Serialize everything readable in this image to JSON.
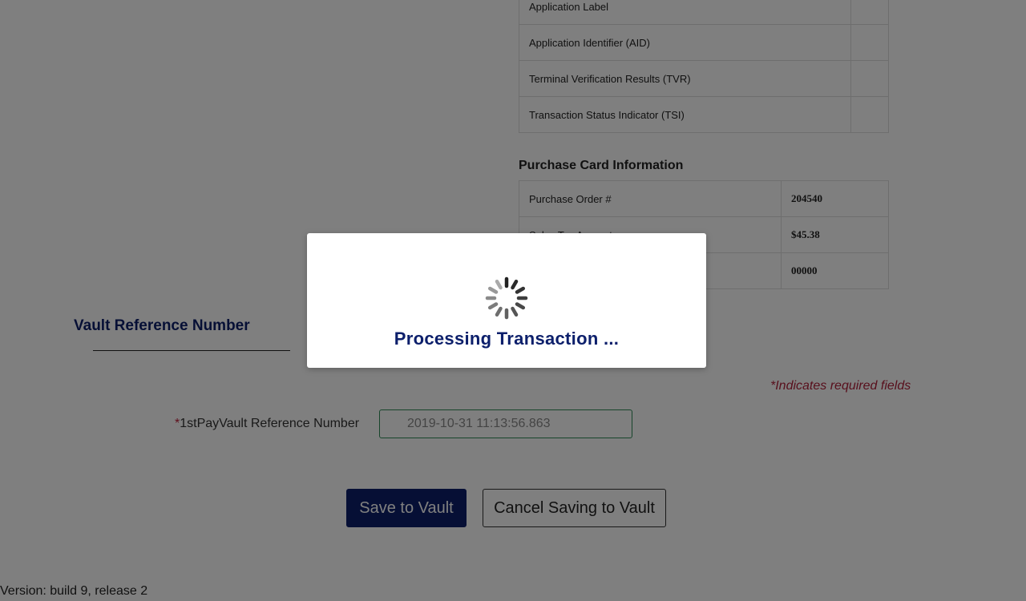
{
  "emv_table": {
    "rows": [
      {
        "label": "Application Label",
        "value": ""
      },
      {
        "label": "Application Identifier (AID)",
        "value": ""
      },
      {
        "label": "Terminal Verification Results (TVR)",
        "value": ""
      },
      {
        "label": "Transaction Status Indicator (TSI)",
        "value": ""
      }
    ]
  },
  "purchase_card": {
    "title": "Purchase Card Information",
    "rows": [
      {
        "label": "Purchase Order #",
        "value": "204540"
      },
      {
        "label": "Sales Tax Amount",
        "value": "$45.38"
      },
      {
        "label": "",
        "value": "00000"
      }
    ]
  },
  "vault": {
    "title": "Vault Reference Number",
    "required_star": "*",
    "required_note": "Indicates required fields",
    "ref_label": "1stPayVault Reference Number",
    "ref_value": "2019-10-31 11:13:56.863",
    "save_label": "Save to Vault",
    "cancel_label": "Cancel Saving to Vault"
  },
  "footer": {
    "version": "Version: build 9, release 2"
  },
  "modal": {
    "message": "Processing Transaction ...",
    "spinner_icon": "loading-spinner-icon"
  },
  "colors": {
    "brand_navy": "#0c1f6b",
    "required_red": "#b0203a",
    "input_border_green": "#2e8b57"
  }
}
